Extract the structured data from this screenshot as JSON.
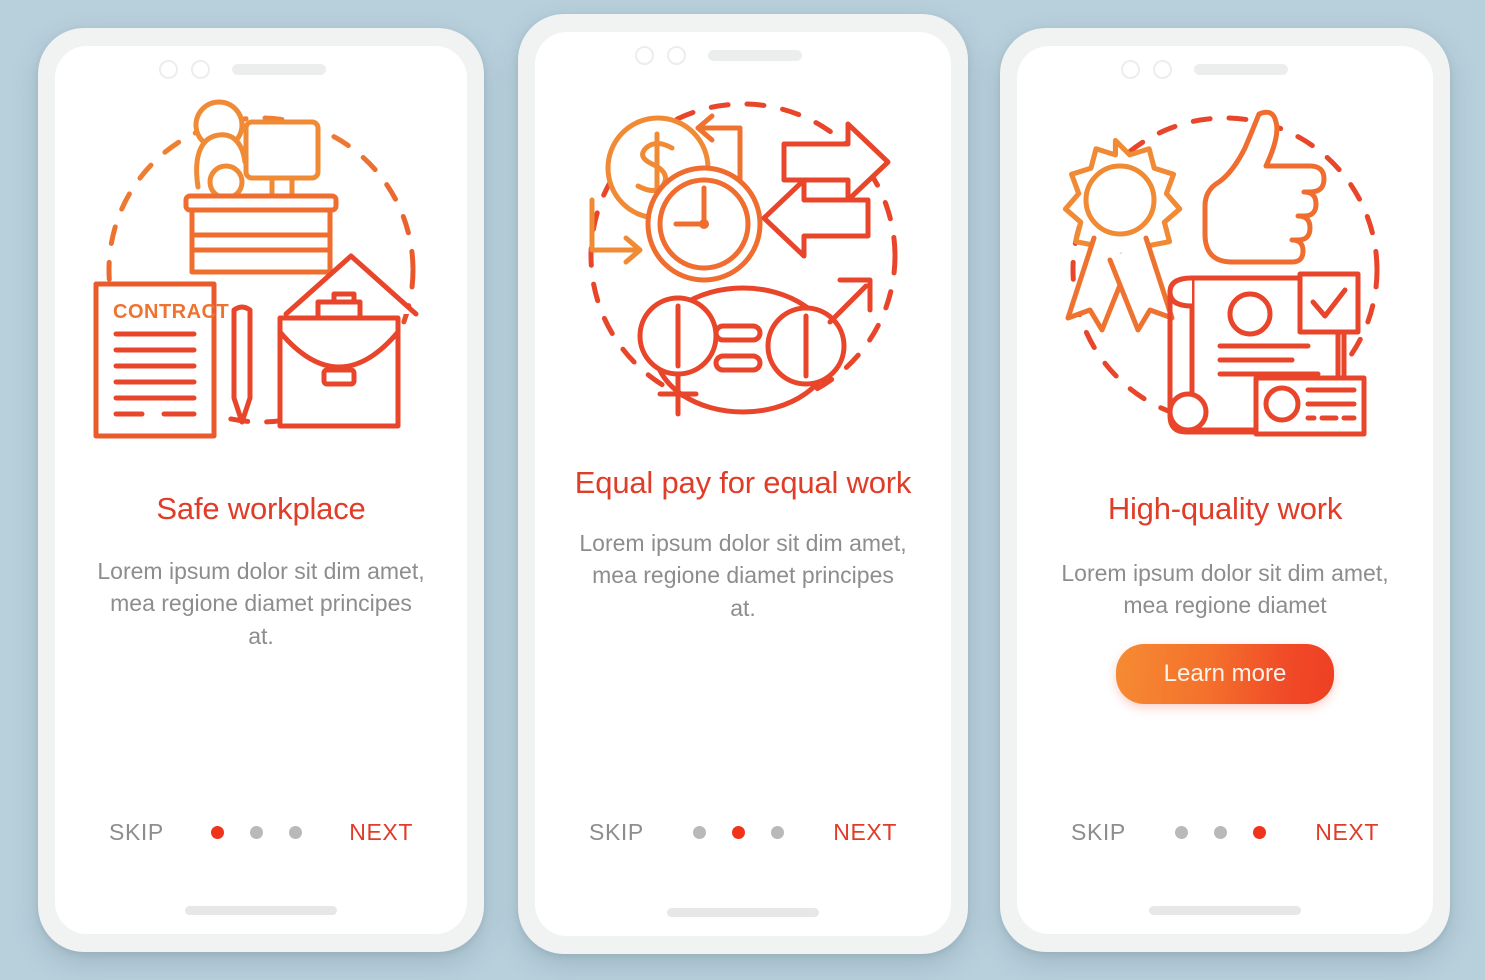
{
  "background_color": "#b8d0dc",
  "theme": {
    "title_color": "#e03c28",
    "desc_color": "#8d8d8d",
    "accent_start": "#f68b33",
    "accent_end": "#ef3f24",
    "dot_active": "#f0331a",
    "dot_inactive": "#b9b9b9",
    "frame_color": "#f1f2f2",
    "screen_color": "#ffffff"
  },
  "screens": [
    {
      "id": "safe-workplace",
      "illustration": "office-desk-contract-briefcase-icon",
      "illustration_label": "CONTRACT",
      "title": "Safe workplace",
      "description": "Lorem ipsum dolor sit dim amet, mea regione diamet principes at.",
      "cta": null,
      "skip_label": "SKIP",
      "next_label": "NEXT",
      "dots": 3,
      "active_dot": 0
    },
    {
      "id": "equal-pay",
      "illustration": "equal-pay-gender-money-clock-icon",
      "illustration_label": "",
      "title": "Equal pay for equal work",
      "description": "Lorem ipsum dolor sit dim amet, mea regione diamet principes at.",
      "cta": null,
      "skip_label": "SKIP",
      "next_label": "NEXT",
      "dots": 3,
      "active_dot": 1
    },
    {
      "id": "high-quality-work",
      "illustration": "award-ribbon-thumbs-up-certificate-icon",
      "illustration_label": "",
      "title": "High-quality work",
      "description": "Lorem ipsum dolor sit dim amet, mea regione diamet",
      "cta": "Learn more",
      "skip_label": "SKIP",
      "next_label": "NEXT",
      "dots": 3,
      "active_dot": 2
    }
  ]
}
